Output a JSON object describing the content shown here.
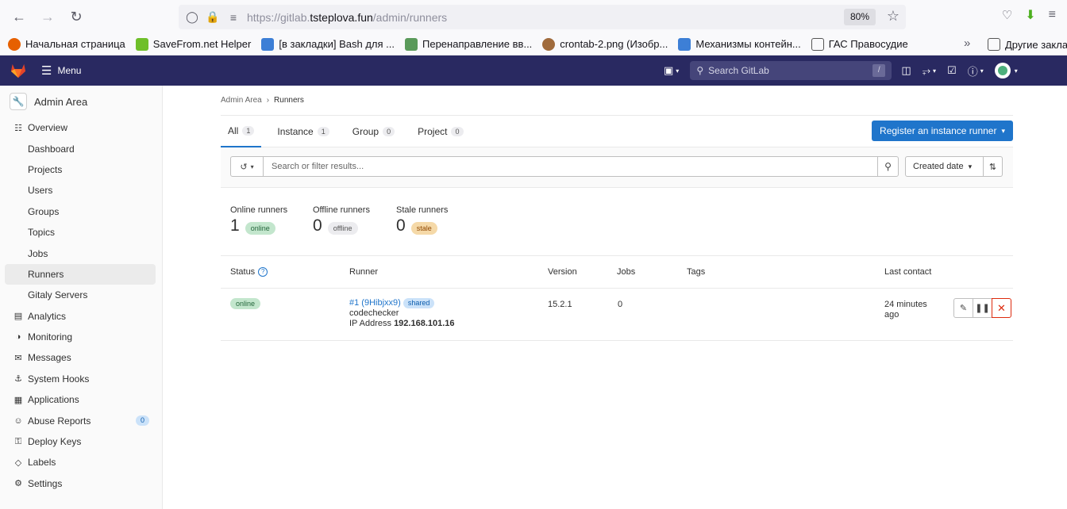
{
  "browser": {
    "url_prefix": "https://gitlab.",
    "url_domain": "tsteplova.fun",
    "url_path": "/admin/runners",
    "zoom": "80%"
  },
  "bookmarks": [
    {
      "label": "Начальная страница",
      "color": "#e66000"
    },
    {
      "label": "SaveFrom.net Helper",
      "color": "#6fbf2a"
    },
    {
      "label": "[в закладки] Bash для ...",
      "color": "#3d7fd6"
    },
    {
      "label": "Перенаправление вв...",
      "color": "#5a9a5a"
    },
    {
      "label": "crontab-2.png (Изобр...",
      "color": "#a06b3c"
    },
    {
      "label": "Механизмы контейн...",
      "color": "#3d7fd6"
    },
    {
      "label": "ГАС Правосудие",
      "color": "#555555"
    }
  ],
  "bookmarks_other": "Другие заклад",
  "header": {
    "menu_label": "Menu",
    "search_placeholder": "Search GitLab",
    "search_shortcut": "/"
  },
  "sidebar": {
    "title": "Admin Area",
    "items": [
      {
        "label": "Overview",
        "icon": "grid-icon",
        "sub": false
      },
      {
        "label": "Dashboard",
        "sub": true
      },
      {
        "label": "Projects",
        "sub": true
      },
      {
        "label": "Users",
        "sub": true
      },
      {
        "label": "Groups",
        "sub": true
      },
      {
        "label": "Topics",
        "sub": true
      },
      {
        "label": "Jobs",
        "sub": true
      },
      {
        "label": "Runners",
        "sub": true,
        "active": true
      },
      {
        "label": "Gitaly Servers",
        "sub": true
      },
      {
        "label": "Analytics",
        "icon": "chart-icon",
        "sub": false
      },
      {
        "label": "Monitoring",
        "icon": "monitor-icon",
        "sub": false
      },
      {
        "label": "Messages",
        "icon": "bullhorn-icon",
        "sub": false
      },
      {
        "label": "System Hooks",
        "icon": "hook-icon",
        "sub": false
      },
      {
        "label": "Applications",
        "icon": "apps-icon",
        "sub": false
      },
      {
        "label": "Abuse Reports",
        "icon": "smiley-icon",
        "sub": false,
        "badge": "0"
      },
      {
        "label": "Deploy Keys",
        "icon": "key-icon",
        "sub": false
      },
      {
        "label": "Labels",
        "icon": "label-icon",
        "sub": false
      },
      {
        "label": "Settings",
        "icon": "gear-icon",
        "sub": false
      }
    ]
  },
  "breadcrumb": {
    "root": "Admin Area",
    "current": "Runners"
  },
  "tabs": [
    {
      "label": "All",
      "count": "1",
      "active": true
    },
    {
      "label": "Instance",
      "count": "1"
    },
    {
      "label": "Group",
      "count": "0"
    },
    {
      "label": "Project",
      "count": "0"
    }
  ],
  "register_button": "Register an instance runner",
  "filter": {
    "placeholder": "Search or filter results...",
    "sort_label": "Created date"
  },
  "stats": [
    {
      "label": "Online runners",
      "count": "1",
      "badge": "online"
    },
    {
      "label": "Offline runners",
      "count": "0",
      "badge": "offline"
    },
    {
      "label": "Stale runners",
      "count": "0",
      "badge": "stale"
    }
  ],
  "table": {
    "headers": {
      "status": "Status",
      "runner": "Runner",
      "version": "Version",
      "jobs": "Jobs",
      "tags": "Tags",
      "last_contact": "Last contact"
    },
    "rows": [
      {
        "status": "online",
        "runner_id": "#1 (9Hibjxx9)",
        "runner_type": "shared",
        "description": "codechecker",
        "ip_label": "IP Address",
        "ip": "192.168.101.16",
        "version": "15.2.1",
        "jobs": "0",
        "tags": "",
        "last_contact_1": "24 minutes",
        "last_contact_2": "ago"
      }
    ]
  }
}
